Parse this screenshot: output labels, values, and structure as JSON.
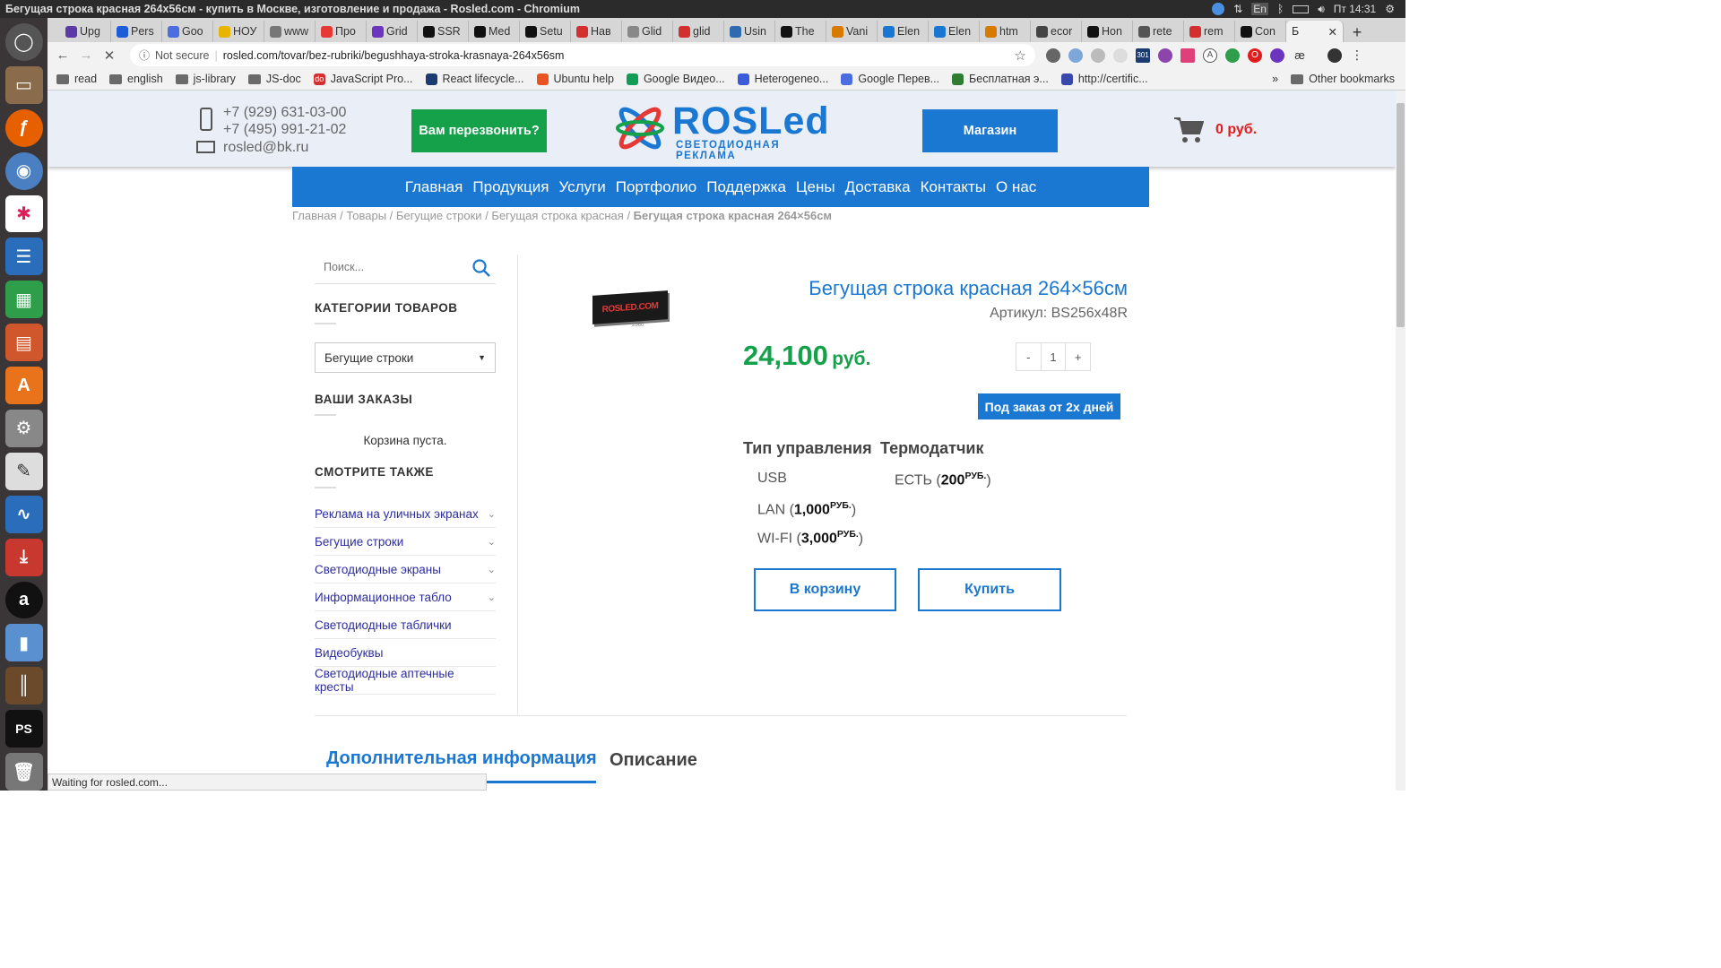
{
  "system": {
    "window_title": "Бегущая строка красная 264x56см - купить в Москве, изготовление и продажа - Rosled.com - Chromium",
    "lang": "En",
    "clock": "Пт 14:31"
  },
  "tabs": [
    {
      "label": "Upg",
      "color": "#5b3aa8"
    },
    {
      "label": "Pers",
      "color": "#1c5cd6"
    },
    {
      "label": "Goo",
      "color": "#4a6ee0"
    },
    {
      "label": "НОУ",
      "color": "#e7b400"
    },
    {
      "label": "www",
      "color": "#777"
    },
    {
      "label": "Про",
      "color": "#e53935"
    },
    {
      "label": "Grid",
      "color": "#6b35c0"
    },
    {
      "label": "SSR",
      "color": "#111"
    },
    {
      "label": "Med",
      "color": "#111"
    },
    {
      "label": "Setu",
      "color": "#111"
    },
    {
      "label": "Нав",
      "color": "#d32f2f"
    },
    {
      "label": "Glid",
      "color": "#888"
    },
    {
      "label": "glid",
      "color": "#d32f2f"
    },
    {
      "label": "Usin",
      "color": "#2d6ab0"
    },
    {
      "label": "The",
      "color": "#111"
    },
    {
      "label": "Vani",
      "color": "#d77a00"
    },
    {
      "label": "Elen",
      "color": "#1976d2"
    },
    {
      "label": "Elen",
      "color": "#1976d2"
    },
    {
      "label": "htm",
      "color": "#d77a00"
    },
    {
      "label": "ecor",
      "color": "#444"
    },
    {
      "label": "Hon",
      "color": "#111"
    },
    {
      "label": "rete",
      "color": "#555"
    },
    {
      "label": "rem",
      "color": "#d32f2f"
    },
    {
      "label": "Con",
      "color": "#111"
    }
  ],
  "active_tab": {
    "label": "Б",
    "close": "✕"
  },
  "new_tab": "+",
  "address": {
    "security": "Not secure",
    "url": "rosled.com/tovar/bez-rubriki/begushhaya-stroka-krasnaya-264x56sm"
  },
  "bookmarks": [
    {
      "label": "read",
      "type": "folder"
    },
    {
      "label": "english",
      "type": "folder"
    },
    {
      "label": "js-library",
      "type": "folder"
    },
    {
      "label": "JS-doc",
      "type": "folder"
    },
    {
      "label": "JavaScript Pro...",
      "type": "site",
      "color": "#d32f2f",
      "icon": "do"
    },
    {
      "label": "React lifecycle...",
      "type": "site",
      "color": "#1c3b70",
      "icon": ""
    },
    {
      "label": "Ubuntu help",
      "type": "site",
      "color": "#e95420",
      "icon": ""
    },
    {
      "label": "Google Видео...",
      "type": "site",
      "color": "#0f9d58",
      "icon": ""
    },
    {
      "label": "Heterogeneo...",
      "type": "site",
      "color": "#3b5bdb",
      "icon": ""
    },
    {
      "label": "Google Перев...",
      "type": "site",
      "color": "#4a6ee0",
      "icon": ""
    },
    {
      "label": "Бесплатная э...",
      "type": "site",
      "color": "#2e7d32",
      "icon": ""
    },
    {
      "label": "http://certific...",
      "type": "site",
      "color": "#3949ab",
      "icon": ""
    }
  ],
  "bookmarks_more": "»",
  "other_bookmarks": "Other bookmarks",
  "site": {
    "phone1": "+7 (929) 631-03-00",
    "phone2": "+7 (495) 991-21-02",
    "email": "rosled@bk.ru",
    "callback_btn": "Вам перезвонить?",
    "logo_main": "ROSLed",
    "logo_sub": "СВЕТОДИОДНАЯ РЕКЛАМА",
    "shop_btn": "Магазин",
    "cart_total": "0 руб.",
    "menu": [
      "Главная",
      "Продукция",
      "Услуги",
      "Портфолио",
      "Поддержка",
      "Цены",
      "Доставка",
      "Контакты",
      "О нас"
    ],
    "breadcrumb": [
      "Главная",
      "Товары",
      "Бегущие строки",
      "Бегущая строка красная"
    ],
    "breadcrumb_current": "Бегущая строка красная 264×56см",
    "search_placeholder": "Поиск...",
    "categories_title": "КАТЕГОРИИ ТОВАРОВ",
    "categories_selected": "Бегущие строки",
    "orders_title": "ВАШИ ЗАКАЗЫ",
    "cart_empty": "Корзина пуста.",
    "see_also_title": "СМОТРИТЕ ТАКЖЕ",
    "see_also": [
      {
        "label": "Реклама на уличных экранах",
        "expand": true
      },
      {
        "label": "Бегущие строки",
        "expand": true
      },
      {
        "label": "Светодиодные экраны",
        "expand": true
      },
      {
        "label": "Информационное табло",
        "expand": true
      },
      {
        "label": "Светодиодные таблички",
        "expand": false
      },
      {
        "label": "Видеобуквы",
        "expand": false
      },
      {
        "label": "Светодиодные аптечные кресты",
        "expand": false
      }
    ],
    "product": {
      "image_text": "ROSLED.COM",
      "image_dim": "2560",
      "title": "Бегущая строка красная 264×56см",
      "sku": "Артикул: BS256x48R",
      "price": "24,100",
      "currency": "руб.",
      "qty_minus": "-",
      "qty": "1",
      "qty_plus": "+",
      "availability": "Под заказ от 2х дней",
      "control_title": "Тип управления",
      "control_options": [
        {
          "label": "USB",
          "price": ""
        },
        {
          "label": "LAN (",
          "price": "1,000",
          "cur": "РУБ.",
          "end": ")"
        },
        {
          "label": "WI-FI (",
          "price": "3,000",
          "cur": "РУБ.",
          "end": ")"
        }
      ],
      "sensor_title": "Термодатчик",
      "sensor_option": {
        "label": "ЕСТЬ (",
        "price": "200",
        "cur": "РУБ.",
        "end": ")"
      },
      "add_to_cart": "В корзину",
      "buy": "Купить"
    },
    "tab_info": "Дополнительная информация",
    "tab_desc": "Описание"
  },
  "status_text": "Waiting for rosled.com...",
  "colors": {
    "accent": "#1a77d2",
    "price_green": "#15a04a",
    "cart_red": "#e01e1e"
  }
}
